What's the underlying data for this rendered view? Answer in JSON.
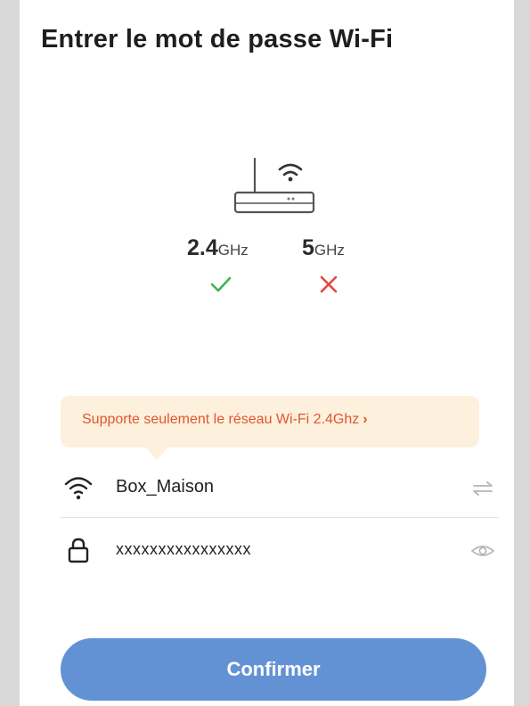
{
  "page": {
    "title": "Entrer le mot de passe Wi-Fi"
  },
  "bands": [
    {
      "value": "2.4",
      "unit": "GHz",
      "supported": true
    },
    {
      "value": "5",
      "unit": "GHz",
      "supported": false
    }
  ],
  "notice": {
    "text": "Supporte seulement le réseau Wi-Fi 2.4Ghz",
    "chevron": "›"
  },
  "form": {
    "ssid": "Box_Maison",
    "password": "xxxxxxxxxxxxxxxx"
  },
  "actions": {
    "confirm_label": "Confirmer"
  },
  "icons": {
    "router": "router-icon",
    "wifi": "wifi-icon",
    "lock": "lock-icon",
    "swap": "swap-icon",
    "eye": "eye-icon",
    "check": "check-icon",
    "cross": "cross-icon"
  },
  "colors": {
    "accent": "#6392d4",
    "notice_bg": "#fdf0dc",
    "notice_text": "#e1562f",
    "ok": "#3fb34f",
    "error": "#e6453c"
  }
}
